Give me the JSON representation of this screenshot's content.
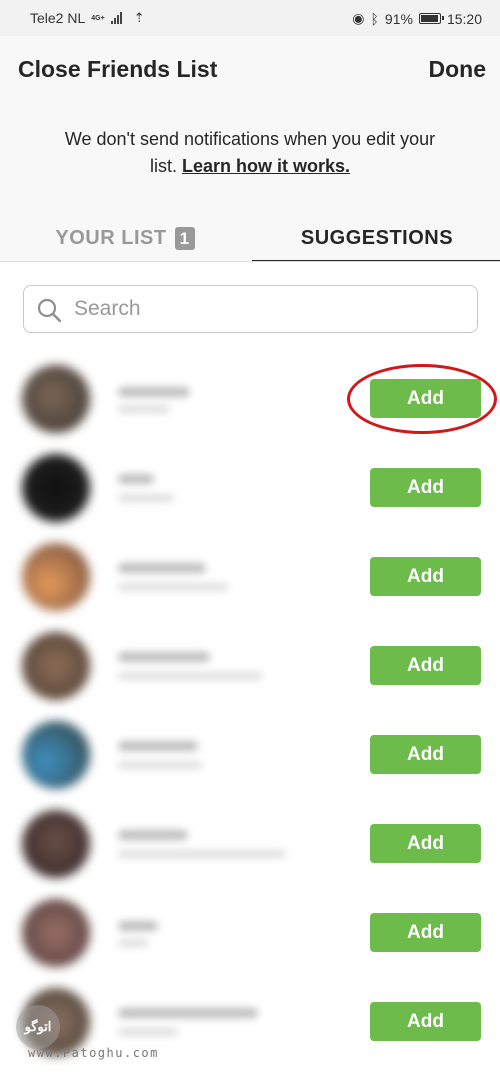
{
  "status_bar": {
    "carrier": "Tele2 NL",
    "network": "4G+",
    "battery": "91%",
    "battery_level": 0.91,
    "time": "15:20"
  },
  "header": {
    "title": "Close Friends List",
    "done_label": "Done",
    "notice_text": "We don't send notifications when you edit your list.",
    "learn_link": "Learn how it works."
  },
  "tabs": [
    {
      "label": "YOUR LIST",
      "badge": "1",
      "active": false
    },
    {
      "label": "SUGGESTIONS",
      "active": true
    }
  ],
  "search": {
    "placeholder": "Search",
    "value": ""
  },
  "suggestions": [
    {
      "add_label": "Add"
    },
    {
      "add_label": "Add"
    },
    {
      "add_label": "Add"
    },
    {
      "add_label": "Add"
    },
    {
      "add_label": "Add"
    },
    {
      "add_label": "Add"
    },
    {
      "add_label": "Add"
    },
    {
      "add_label": "Add"
    }
  ],
  "watermark": {
    "logo_text": "اتوگو",
    "site": "www.Patoghu.com"
  },
  "colors": {
    "add_button": "#6cbb4b",
    "highlight_ring": "#d11818",
    "header_bg": "#f8f8f8"
  }
}
